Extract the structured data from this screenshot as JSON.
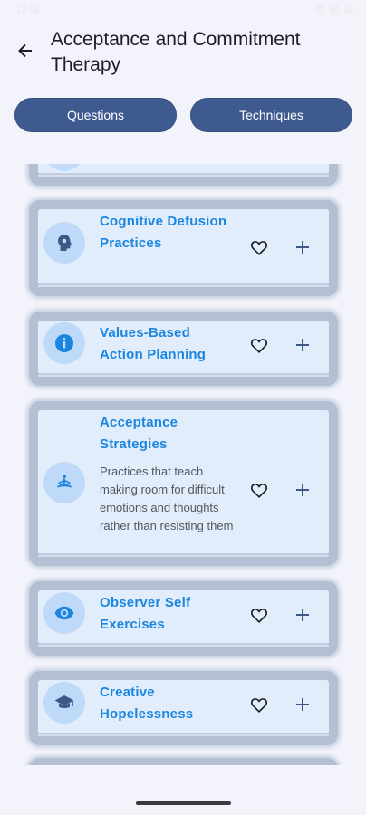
{
  "status": {
    "time": "12:18"
  },
  "header": {
    "title": "Acceptance and Commitment Therapy"
  },
  "segments": [
    {
      "label": "Questions"
    },
    {
      "label": "Techniques"
    }
  ],
  "cards": [
    {
      "title": "Cognitive Defusion Practices",
      "description": "",
      "icon": "brain-head-icon"
    },
    {
      "title": "Values-Based Action Planning",
      "description": "",
      "icon": "info-icon"
    },
    {
      "title": "Acceptance Strategies",
      "description": "Practices that teach making room for difficult emotions and thoughts rather than resisting them",
      "icon": "meditation-icon"
    },
    {
      "title": "Observer Self Exercises",
      "description": "",
      "icon": "eye-icon"
    },
    {
      "title": "Creative Hopelessness",
      "description": "",
      "icon": "graduation-cap-icon"
    }
  ],
  "colors": {
    "accent": "#1a86e0",
    "segment_bg": "#3e5a8f",
    "card_bg": "#e2edfc",
    "card_frame": "#b3c0d3",
    "icon_bg": "#bfdaf8",
    "action_icon": "#3d5887"
  }
}
